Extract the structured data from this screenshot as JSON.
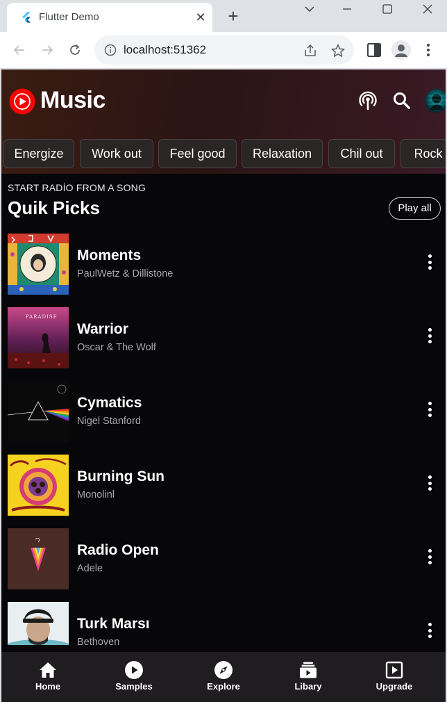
{
  "browser": {
    "tab_title": "Flutter Demo",
    "url": "localhost:51362"
  },
  "app": {
    "brand": "Music",
    "chips": [
      "Energize",
      "Work out",
      "Feel good",
      "Relaxation",
      "Chil out",
      "Rock"
    ],
    "section": {
      "kicker": "START RADİO FROM A SONG",
      "title": "Quik Picks",
      "play_all_label": "Play all"
    },
    "songs": [
      {
        "title": "Moments",
        "artist": "PaulWetz & Dillistone"
      },
      {
        "title": "Warrior",
        "artist": "Oscar & The Wolf"
      },
      {
        "title": "Cymatics",
        "artist": "Nigel Stanford"
      },
      {
        "title": "Burning Sun",
        "artist": "Monolinl"
      },
      {
        "title": "Radio Open",
        "artist": "Adele"
      },
      {
        "title": "Turk Marsı",
        "artist": "Bethoven"
      }
    ],
    "bottom_nav": [
      {
        "label": "Home",
        "icon": "home-icon"
      },
      {
        "label": "Samples",
        "icon": "play-circle-icon"
      },
      {
        "label": "Explore",
        "icon": "compass-icon"
      },
      {
        "label": "Libary",
        "icon": "library-icon"
      },
      {
        "label": "Upgrade",
        "icon": "upgrade-icon"
      }
    ],
    "colors": {
      "background": "#070608",
      "accent_red": "#ff0000",
      "nav_bar": "#1f1d1f",
      "chip_bg": "#2b2626"
    }
  }
}
